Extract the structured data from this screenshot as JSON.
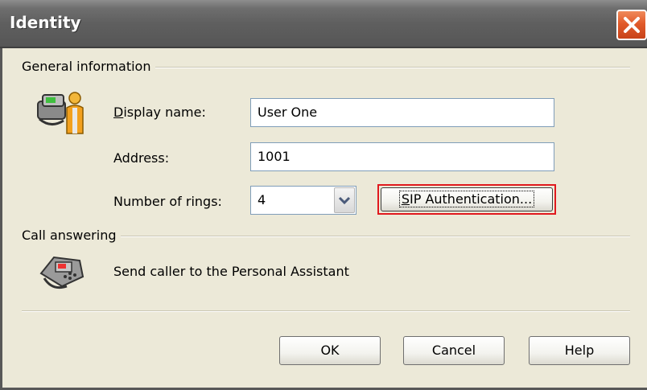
{
  "window": {
    "title": "Identity",
    "close_icon": "close-icon"
  },
  "general": {
    "group_label": "General information",
    "icon": "phone-user-icon",
    "display_name": {
      "label": "Display name:",
      "accel": "D",
      "label_rest": "isplay name:",
      "value": "User One"
    },
    "address": {
      "label": "Address:",
      "value": "1001"
    },
    "rings": {
      "label": "Number of rings:",
      "value": "4",
      "dropdown_icon": "chevron-down-icon"
    },
    "sip_button": {
      "label": "SIP Authentication...",
      "accel": "S",
      "label_rest": "IP Authentication..."
    }
  },
  "call_answering": {
    "group_label": "Call answering",
    "icon": "telephone-icon",
    "text": "Send caller to the Personal Assistant"
  },
  "buttons": {
    "ok": "OK",
    "cancel": "Cancel",
    "help": "Help"
  },
  "colors": {
    "highlight": "#e0191e",
    "dialog_bg": "#ece9d8",
    "close_button": "#e15a2a"
  }
}
